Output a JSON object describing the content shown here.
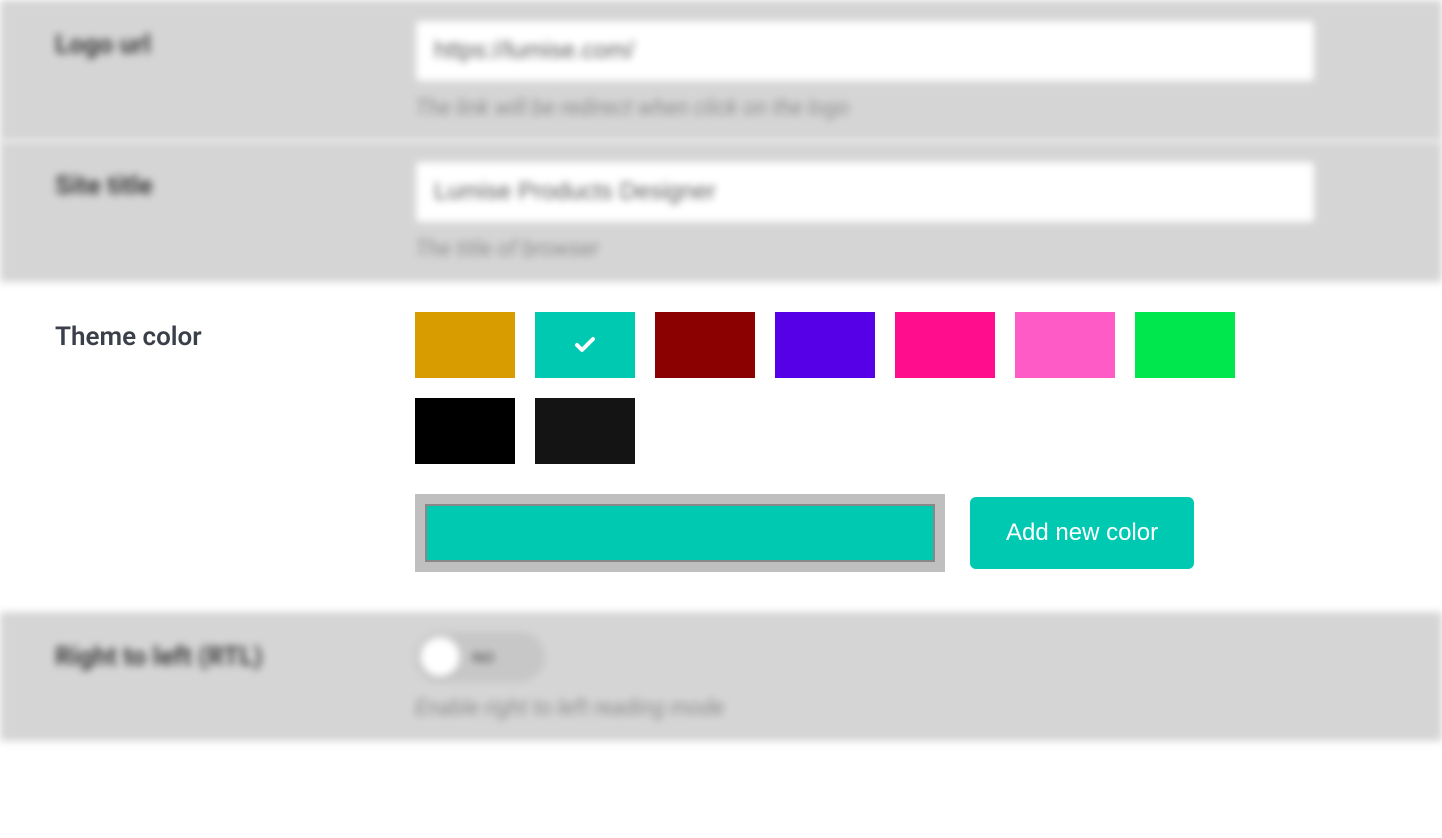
{
  "logo_url": {
    "label": "Logo url",
    "value": "https://lumise.com/",
    "helper": "The link will be redirect when click on the logo"
  },
  "site_title": {
    "label": "Site title",
    "value": "Lumise Products Designer",
    "helper": "The title of browser"
  },
  "theme_color": {
    "label": "Theme color",
    "swatches": [
      {
        "color": "#d89c00",
        "selected": false
      },
      {
        "color": "#00c9b1",
        "selected": true
      },
      {
        "color": "#8b0000",
        "selected": false
      },
      {
        "color": "#5500e6",
        "selected": false
      },
      {
        "color": "#ff0d8c",
        "selected": false
      },
      {
        "color": "#ff5bc6",
        "selected": false
      },
      {
        "color": "#00e64d",
        "selected": false
      },
      {
        "color": "#000000",
        "selected": false
      },
      {
        "color": "#141414",
        "selected": false
      }
    ],
    "custom_color": "#00c9b1",
    "add_button": "Add new color"
  },
  "rtl": {
    "label": "Right to left (RTL)",
    "value": "NO",
    "helper": "Enable right to left reading mode"
  }
}
